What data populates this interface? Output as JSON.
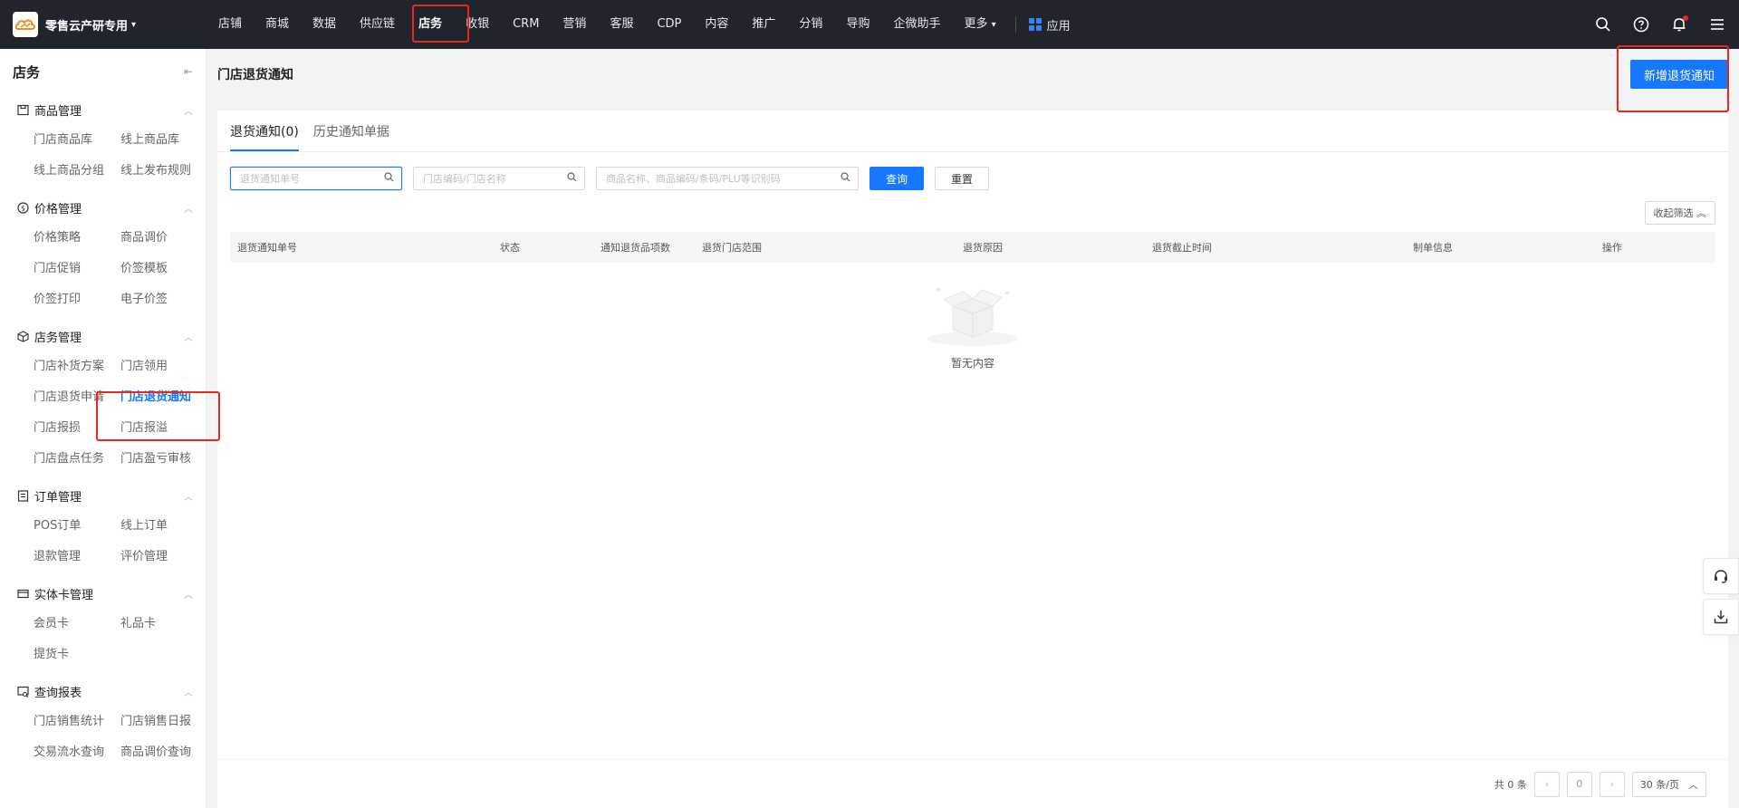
{
  "brand": {
    "name": "零售云产研专用",
    "logo_icon": "cloud-logo-icon"
  },
  "nav": {
    "items": [
      "店铺",
      "商城",
      "数据",
      "供应链",
      "店务",
      "收银",
      "CRM",
      "营销",
      "客服",
      "CDP",
      "内容",
      "推广",
      "分销",
      "导购",
      "企微助手",
      "更多"
    ],
    "active": "店务",
    "apps_label": "应用"
  },
  "top_icons": [
    "search-icon",
    "help-icon",
    "bell-icon",
    "menu-icon"
  ],
  "sidebar": {
    "title": "店务",
    "groups": [
      {
        "title": "商品管理",
        "icon": "product-icon",
        "items": [
          "门店商品库",
          "线上商品库",
          "线上商品分组",
          "线上发布规则"
        ]
      },
      {
        "title": "价格管理",
        "icon": "dollar-icon",
        "items": [
          "价格策略",
          "商品调价",
          "门店促销",
          "价签模板",
          "价签打印",
          "电子价签"
        ]
      },
      {
        "title": "店务管理",
        "icon": "cube-icon",
        "items": [
          "门店补货方案",
          "门店领用",
          "门店退货申请",
          "门店退货通知",
          "门店报损",
          "门店报溢",
          "门店盘点任务",
          "门店盈亏审核"
        ]
      },
      {
        "title": "订单管理",
        "icon": "order-icon",
        "items": [
          "POS订单",
          "线上订单",
          "退款管理",
          "评价管理"
        ]
      },
      {
        "title": "实体卡管理",
        "icon": "card-icon",
        "items": [
          "会员卡",
          "礼品卡",
          "提货卡"
        ]
      },
      {
        "title": "查询报表",
        "icon": "report-icon",
        "items": [
          "门店销售统计",
          "门店销售日报",
          "交易流水查询",
          "商品调价查询"
        ]
      }
    ],
    "active_item": "门店退货通知"
  },
  "page": {
    "title": "门店退货通知",
    "new_button": "新增退货通知",
    "tabs": [
      "退货通知(0)",
      "历史通知单据"
    ],
    "active_tab": "退货通知(0)",
    "filters": {
      "order_no_placeholder": "退货通知单号",
      "store_placeholder": "门店编码/门店名称",
      "product_placeholder": "商品名称、商品编码/条码/PLU等识别码",
      "query": "查询",
      "reset": "重置"
    },
    "collapse_filter": "收起筛选",
    "columns": [
      "退货通知单号",
      "状态",
      "通知退货品项数",
      "退货门店范围",
      "退货原因",
      "退货截止时间",
      "制单信息",
      "操作"
    ],
    "empty_text": "暂无内容"
  },
  "pagination": {
    "total": "共 0 条",
    "current_page": "0",
    "page_size": "30 条/页"
  },
  "float_icons": [
    "headset-icon",
    "download-icon"
  ],
  "colors": {
    "accent": "#1677ff",
    "topbar": "#20242c",
    "highlight": "#e8271d"
  }
}
